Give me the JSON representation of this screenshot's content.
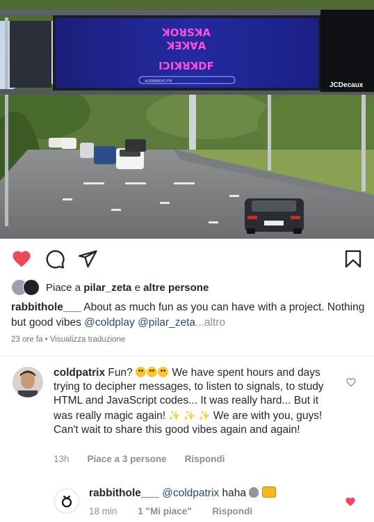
{
  "post": {
    "billboard_brand": "JCDecaux",
    "billboard_line_1": "ꓘꓳꓤꓢꓘꓮ",
    "billboard_line_2": "ꓘꓱꓘꓯꓮ",
    "billboard_line_3": "ꓲꓛꓲꓘꓤꓘꓓꓝ",
    "billboard_footer": "ALIENRADIO FM"
  },
  "actions": {
    "like_icon": "heart-filled-icon",
    "comment_icon": "comment-icon",
    "share_icon": "paper-plane-icon",
    "save_icon": "bookmark-icon",
    "like_color": "#ed4956"
  },
  "likes": {
    "prefix": "Piace a ",
    "user": "pilar_zeta",
    "middle": " e ",
    "others": "altre persone"
  },
  "caption": {
    "username": "rabbithole___",
    "text_1": " About as much fun as you can have with a project. Nothing but good vibes ",
    "mention_1": "@coldplay",
    "mention_2": "@pilar_zeta",
    "more": "...altro"
  },
  "meta": {
    "time": "23 ore fa",
    "separator": "•",
    "translate": "Visualizza traduzione"
  },
  "comment": {
    "username": "coldpatrix",
    "text_a": " Fun? ",
    "text_b": " We have spent hours and days trying to decipher messages, to listen to signals, to study HTML and JavaScript codes... It was really hard... But it was really magic again! ",
    "text_c": " We are with you, guys! Can't wait to share this good vibes again and again!",
    "time": "13h",
    "likes": "Piace a 3 persone",
    "reply": "Rispondi"
  },
  "reply": {
    "username": "rabbithole___",
    "mention": "@coldpatrix",
    "text": " haha ",
    "time": "18 min",
    "likes": "1 \"Mi piace\"",
    "reply": "Rispondi"
  }
}
